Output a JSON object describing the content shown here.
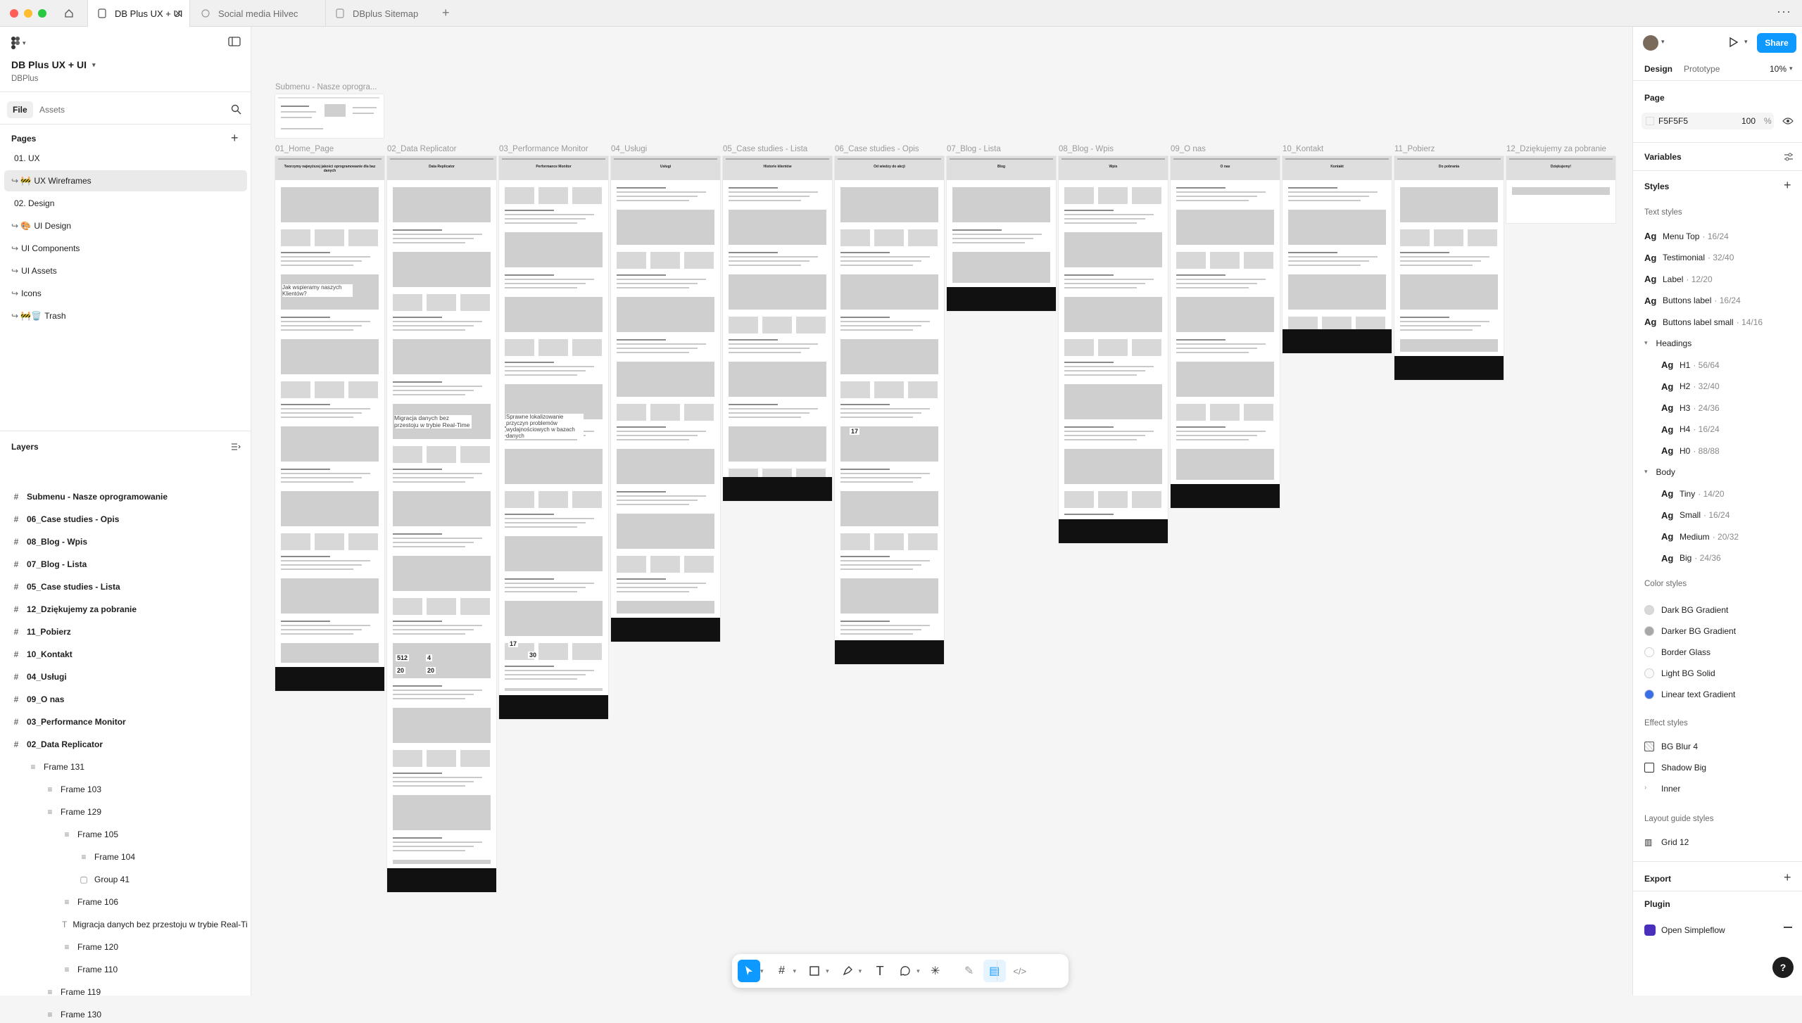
{
  "tabs": [
    {
      "label": "DB Plus UX + UI",
      "active": true
    },
    {
      "label": "Social media Hilvec",
      "active": false
    },
    {
      "label": "DBplus Sitemap",
      "active": false
    }
  ],
  "file": {
    "name": "DB Plus UX + UI",
    "team": "DBPlus"
  },
  "panel_tabs": {
    "file": "File",
    "assets": "Assets"
  },
  "pages": {
    "heading": "Pages",
    "items": [
      {
        "label": "01. UX",
        "selected": false
      },
      {
        "label": "UX Wireframes",
        "prefix": "↪ 🚧",
        "selected": true
      },
      {
        "label": "02. Design",
        "selected": false
      },
      {
        "label": "UI Design",
        "prefix": "↪ 🎨",
        "selected": false
      },
      {
        "label": "UI Components",
        "prefix": "↪",
        "selected": false
      },
      {
        "label": "UI Assets",
        "prefix": "↪",
        "selected": false
      },
      {
        "label": "Icons",
        "prefix": "↪",
        "selected": false
      },
      {
        "label": "Trash",
        "prefix": "↪ 🚧🗑️",
        "selected": false
      }
    ]
  },
  "layers": {
    "heading": "Layers",
    "items": [
      {
        "label": "Submenu - Nasze oprogramowanie",
        "bold": true,
        "indent": 0,
        "icon": "#"
      },
      {
        "label": "06_Case studies - Opis",
        "bold": true,
        "indent": 0,
        "icon": "#"
      },
      {
        "label": "08_Blog - Wpis",
        "bold": true,
        "indent": 0,
        "icon": "#"
      },
      {
        "label": "07_Blog - Lista",
        "bold": true,
        "indent": 0,
        "icon": "#"
      },
      {
        "label": "05_Case studies - Lista",
        "bold": true,
        "indent": 0,
        "icon": "#"
      },
      {
        "label": "12_Dziękujemy za pobranie",
        "bold": true,
        "indent": 0,
        "icon": "#"
      },
      {
        "label": "11_Pobierz",
        "bold": true,
        "indent": 0,
        "icon": "#"
      },
      {
        "label": "10_Kontakt",
        "bold": true,
        "indent": 0,
        "icon": "#"
      },
      {
        "label": "04_Usługi",
        "bold": true,
        "indent": 0,
        "icon": "#"
      },
      {
        "label": "09_O nas",
        "bold": true,
        "indent": 0,
        "icon": "#"
      },
      {
        "label": "03_Performance Monitor",
        "bold": true,
        "indent": 0,
        "icon": "#"
      },
      {
        "label": "02_Data Replicator",
        "bold": true,
        "indent": 0,
        "icon": "#"
      },
      {
        "label": "Frame 131",
        "bold": false,
        "indent": 1,
        "icon": "≡"
      },
      {
        "label": "Frame 103",
        "bold": false,
        "indent": 2,
        "icon": "≡"
      },
      {
        "label": "Frame 129",
        "bold": false,
        "indent": 2,
        "icon": "≡"
      },
      {
        "label": "Frame 105",
        "bold": false,
        "indent": 3,
        "icon": "≡"
      },
      {
        "label": "Frame 104",
        "bold": false,
        "indent": 4,
        "icon": "≡"
      },
      {
        "label": "Group 41",
        "bold": false,
        "indent": 4,
        "icon": "▢"
      },
      {
        "label": "Frame 106",
        "bold": false,
        "indent": 3,
        "icon": "≡"
      },
      {
        "label": "Migracja danych bez przestoju w trybie Real-Time",
        "bold": false,
        "indent": 3,
        "icon": "T"
      },
      {
        "label": "Frame 120",
        "bold": false,
        "indent": 3,
        "icon": "≡"
      },
      {
        "label": "Frame 110",
        "bold": false,
        "indent": 3,
        "icon": "≡"
      },
      {
        "label": "Frame 119",
        "bold": false,
        "indent": 2,
        "icon": "≡"
      },
      {
        "label": "Frame 130",
        "bold": false,
        "indent": 2,
        "icon": "≡"
      }
    ]
  },
  "canvas": {
    "submenu_label": "Submenu - Nasze oprogra...",
    "frames": [
      {
        "label": "01_Home_Page",
        "heading": "Tworzymy najwyższej jakości oprogramowanie dla baz danych"
      },
      {
        "label": "02_Data Replicator",
        "heading": "Data Replicator"
      },
      {
        "label": "03_Performance Monitor",
        "heading": "Performance Monitor"
      },
      {
        "label": "04_Usługi",
        "heading": "Usługi"
      },
      {
        "label": "05_Case studies - Lista",
        "heading": "Historie klientów"
      },
      {
        "label": "06_Case studies - Opis",
        "heading": "Od wiedzy do akcji"
      },
      {
        "label": "07_Blog - Lista",
        "heading": "Blog"
      },
      {
        "label": "08_Blog - Wpis",
        "heading": "Wpis"
      },
      {
        "label": "09_O nas",
        "heading": "O nas"
      },
      {
        "label": "10_Kontakt",
        "heading": "Kontakt"
      },
      {
        "label": "11_Pobierz",
        "heading": "Do pobrania"
      },
      {
        "label": "12_Dziękujemy za pobranie",
        "heading": "Dziękujemy!"
      }
    ],
    "home_text": "Jak wspieramy naszych Klientów?",
    "replicator_text": "Migracja danych bez przestoju w trybie Real-Time",
    "monitor_text": "Sprawne lokalizowanie przyczyn problemów wydajnościowych w bazach danych",
    "stats": [
      "512",
      "4",
      "20",
      "20",
      "17",
      "30",
      "17"
    ]
  },
  "right": {
    "tabs": {
      "design": "Design",
      "prototype": "Prototype"
    },
    "zoom": "10%",
    "share": "Share",
    "page": {
      "heading": "Page",
      "color": "F5F5F5",
      "opacity": "100",
      "unit": "%"
    },
    "variables": "Variables",
    "styles": "Styles",
    "text_styles": {
      "heading": "Text styles",
      "items": [
        {
          "name": "Menu Top",
          "meta": "· 16/24"
        },
        {
          "name": "Testimonial",
          "meta": "· 32/40"
        },
        {
          "name": "Label",
          "meta": "· 12/20"
        },
        {
          "name": "Buttons label",
          "meta": "· 16/24"
        },
        {
          "name": "Buttons label small",
          "meta": "· 14/16"
        }
      ],
      "headings_group": "Headings",
      "headings": [
        {
          "name": "H1",
          "meta": "· 56/64"
        },
        {
          "name": "H2",
          "meta": "· 32/40"
        },
        {
          "name": "H3",
          "meta": "· 24/36"
        },
        {
          "name": "H4",
          "meta": "· 16/24"
        },
        {
          "name": "H0",
          "meta": "· 88/88"
        }
      ],
      "body_group": "Body",
      "body": [
        {
          "name": "Tiny",
          "meta": "· 14/20"
        },
        {
          "name": "Small",
          "meta": "· 16/24"
        },
        {
          "name": "Medium",
          "meta": "· 20/32"
        },
        {
          "name": "Big",
          "meta": "· 24/36"
        }
      ]
    },
    "color_styles": {
      "heading": "Color styles",
      "items": [
        {
          "name": "Dark BG Gradient",
          "color": "#d9d9d9"
        },
        {
          "name": "Darker BG Gradient",
          "color": "#a8a8a8"
        },
        {
          "name": "Border Glass",
          "color": "#ffffff"
        },
        {
          "name": "Light BG Solid",
          "color": "#fafafa"
        },
        {
          "name": "Linear text Gradient",
          "color": "#3a6ee8"
        }
      ]
    },
    "effect_styles": {
      "heading": "Effect styles",
      "items": [
        "BG Blur 4",
        "Shadow Big",
        "Inner"
      ]
    },
    "layout_guides": {
      "heading": "Layout guide styles",
      "items": [
        "Grid 12"
      ]
    },
    "export": "Export",
    "plugin": {
      "heading": "Plugin",
      "item": "Open Simpleflow"
    },
    "help": "?"
  }
}
